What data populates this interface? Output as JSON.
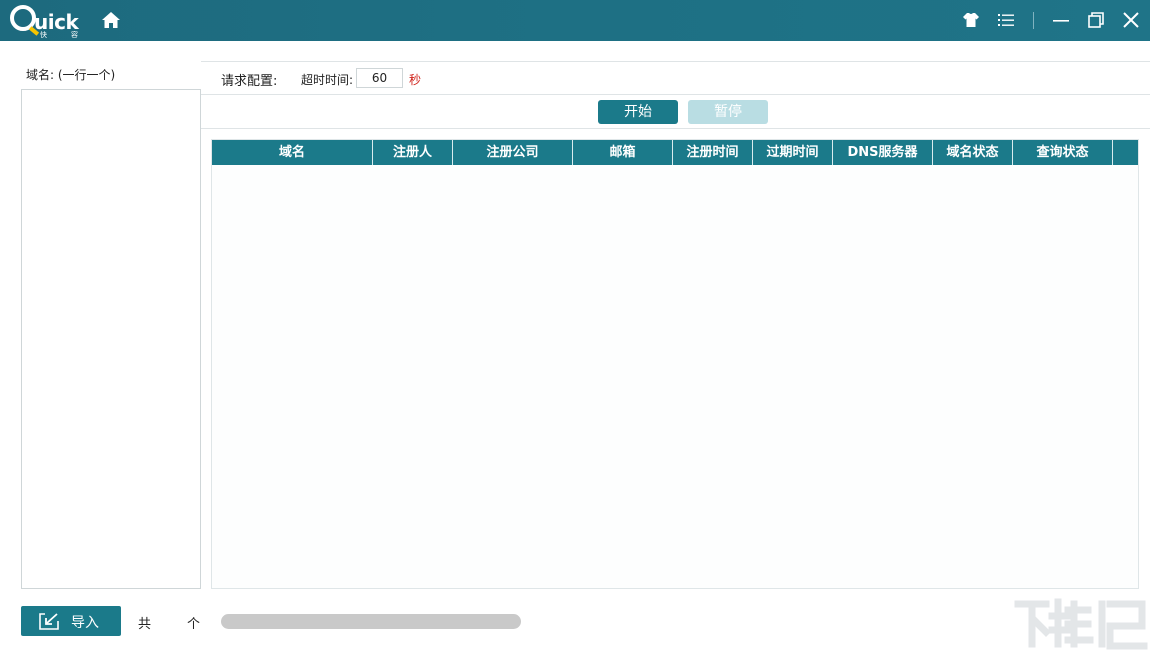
{
  "app": {
    "logo_text": "uick",
    "logo_sub_left": "快",
    "logo_sub_right": "容"
  },
  "titlebar": {
    "icons": [
      "home-icon",
      "skin-icon",
      "menu-icon",
      "minimize-icon",
      "restore-icon",
      "close-icon"
    ]
  },
  "left_panel": {
    "label": "域名:  (一行一个)",
    "textarea_value": ""
  },
  "config": {
    "title": "请求配置:",
    "timeout_label": "超时时间:",
    "timeout_value": "60",
    "timeout_unit": "秒"
  },
  "controls": {
    "start_label": "开始",
    "pause_label": "暂停"
  },
  "table": {
    "columns": [
      "域名",
      "注册人",
      "注册公司",
      "邮箱",
      "注册时间",
      "过期时间",
      "DNS服务器",
      "域名状态",
      "查询状态"
    ],
    "rows": []
  },
  "footer": {
    "import_label": "导入",
    "total_label": "共",
    "count_value": "",
    "unit_label": "个",
    "progress_fraction": 0
  },
  "colors": {
    "titlebar": "#1e6f83",
    "accent": "#1b7a8a",
    "disabled_button": "#b9dde3",
    "unit_red": "#d0231b"
  }
}
